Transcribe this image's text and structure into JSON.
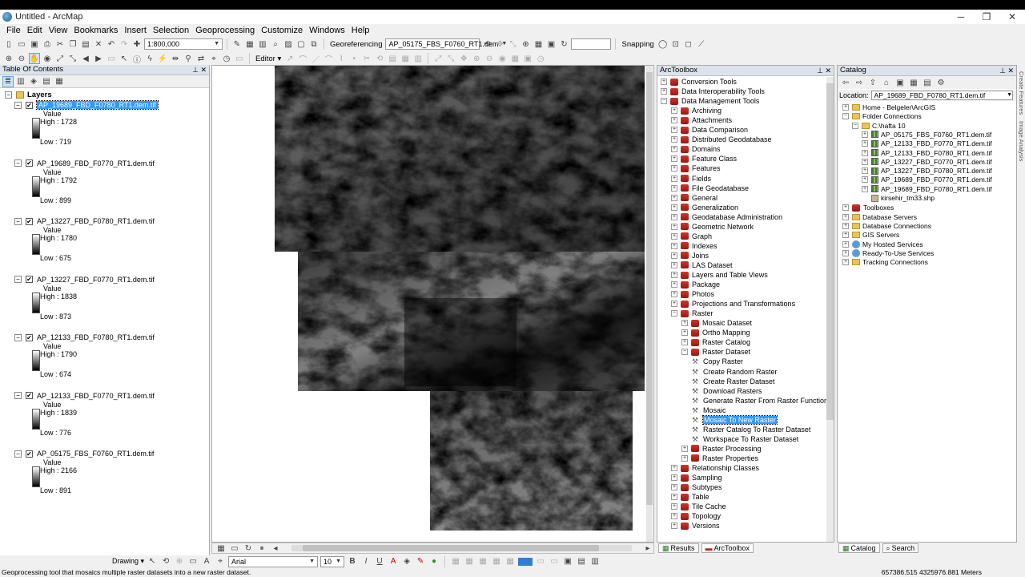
{
  "window": {
    "title": "Untitled - ArcMap",
    "minimize": "─",
    "maximize": "❐",
    "close": "✕"
  },
  "menu": [
    "File",
    "Edit",
    "View",
    "Bookmarks",
    "Insert",
    "Selection",
    "Geoprocessing",
    "Customize",
    "Windows",
    "Help"
  ],
  "toolbar": {
    "scale": "1:800,000",
    "georeferencing_label": "Georeferencing",
    "georef_layer": "AP_05175_FBS_F0760_RT1.dem",
    "snapping_label": "Snapping",
    "editor_label": "Editor"
  },
  "toc": {
    "title": "Table Of Contents",
    "root": "Layers",
    "layers": [
      {
        "name": "AP_19689_FBD_F0780_RT1.dem.tif",
        "value_label": "Value",
        "high": "High : 1728",
        "low": "Low : 719",
        "selected": true
      },
      {
        "name": "AP_19689_FBD_F0770_RT1.dem.tif",
        "value_label": "Value",
        "high": "High : 1792",
        "low": "Low : 899"
      },
      {
        "name": "AP_13227_FBD_F0780_RT1.dem.tif",
        "value_label": "Value",
        "high": "High : 1780",
        "low": "Low : 675"
      },
      {
        "name": "AP_13227_FBD_F0770_RT1.dem.tif",
        "value_label": "Value",
        "high": "High : 1838",
        "low": "Low : 873"
      },
      {
        "name": "AP_12133_FBD_F0780_RT1.dem.tif",
        "value_label": "Value",
        "high": "High : 1790",
        "low": "Low : 674"
      },
      {
        "name": "AP_12133_FBD_F0770_RT1.dem.tif",
        "value_label": "Value",
        "high": "High : 1839",
        "low": "Low : 776"
      },
      {
        "name": "AP_05175_FBS_F0760_RT1.dem.tif",
        "value_label": "Value",
        "high": "High : 2166",
        "low": "Low : 891"
      }
    ]
  },
  "arctoolbox": {
    "title": "ArcToolbox",
    "items": [
      {
        "label": "Conversion Tools",
        "level": 0,
        "kind": "toolbox",
        "exp": "+"
      },
      {
        "label": "Data Interoperability Tools",
        "level": 0,
        "kind": "toolbox",
        "exp": "+"
      },
      {
        "label": "Data Management Tools",
        "level": 0,
        "kind": "toolbox",
        "exp": "−"
      },
      {
        "label": "Archiving",
        "level": 1,
        "kind": "toolbox",
        "exp": "+"
      },
      {
        "label": "Attachments",
        "level": 1,
        "kind": "toolbox",
        "exp": "+"
      },
      {
        "label": "Data Comparison",
        "level": 1,
        "kind": "toolbox",
        "exp": "+"
      },
      {
        "label": "Distributed Geodatabase",
        "level": 1,
        "kind": "toolbox",
        "exp": "+"
      },
      {
        "label": "Domains",
        "level": 1,
        "kind": "toolbox",
        "exp": "+"
      },
      {
        "label": "Feature Class",
        "level": 1,
        "kind": "toolbox",
        "exp": "+"
      },
      {
        "label": "Features",
        "level": 1,
        "kind": "toolbox",
        "exp": "+"
      },
      {
        "label": "Fields",
        "level": 1,
        "kind": "toolbox",
        "exp": "+"
      },
      {
        "label": "File Geodatabase",
        "level": 1,
        "kind": "toolbox",
        "exp": "+"
      },
      {
        "label": "General",
        "level": 1,
        "kind": "toolbox",
        "exp": "+"
      },
      {
        "label": "Generalization",
        "level": 1,
        "kind": "toolbox",
        "exp": "+"
      },
      {
        "label": "Geodatabase Administration",
        "level": 1,
        "kind": "toolbox",
        "exp": "+"
      },
      {
        "label": "Geometric Network",
        "level": 1,
        "kind": "toolbox",
        "exp": "+"
      },
      {
        "label": "Graph",
        "level": 1,
        "kind": "toolbox",
        "exp": "+"
      },
      {
        "label": "Indexes",
        "level": 1,
        "kind": "toolbox",
        "exp": "+"
      },
      {
        "label": "Joins",
        "level": 1,
        "kind": "toolbox",
        "exp": "+"
      },
      {
        "label": "LAS Dataset",
        "level": 1,
        "kind": "toolbox",
        "exp": "+"
      },
      {
        "label": "Layers and Table Views",
        "level": 1,
        "kind": "toolbox",
        "exp": "+"
      },
      {
        "label": "Package",
        "level": 1,
        "kind": "toolbox",
        "exp": "+"
      },
      {
        "label": "Photos",
        "level": 1,
        "kind": "toolbox",
        "exp": "+"
      },
      {
        "label": "Projections and Transformations",
        "level": 1,
        "kind": "toolbox",
        "exp": "+"
      },
      {
        "label": "Raster",
        "level": 1,
        "kind": "toolbox",
        "exp": "−"
      },
      {
        "label": "Mosaic Dataset",
        "level": 2,
        "kind": "toolbox",
        "exp": "+"
      },
      {
        "label": "Ortho Mapping",
        "level": 2,
        "kind": "toolbox",
        "exp": "+"
      },
      {
        "label": "Raster Catalog",
        "level": 2,
        "kind": "toolbox",
        "exp": "+"
      },
      {
        "label": "Raster Dataset",
        "level": 2,
        "kind": "toolbox",
        "exp": "−"
      },
      {
        "label": "Copy Raster",
        "level": 3,
        "kind": "tool"
      },
      {
        "label": "Create Random Raster",
        "level": 3,
        "kind": "tool"
      },
      {
        "label": "Create Raster Dataset",
        "level": 3,
        "kind": "tool"
      },
      {
        "label": "Download Rasters",
        "level": 3,
        "kind": "tool"
      },
      {
        "label": "Generate Raster From Raster Function",
        "level": 3,
        "kind": "tool"
      },
      {
        "label": "Mosaic",
        "level": 3,
        "kind": "tool"
      },
      {
        "label": "Mosaic To New Raster",
        "level": 3,
        "kind": "tool",
        "selected": true
      },
      {
        "label": "Raster Catalog To Raster Dataset",
        "level": 3,
        "kind": "tool"
      },
      {
        "label": "Workspace To Raster Dataset",
        "level": 3,
        "kind": "tool"
      },
      {
        "label": "Raster Processing",
        "level": 2,
        "kind": "toolbox",
        "exp": "+"
      },
      {
        "label": "Raster Properties",
        "level": 2,
        "kind": "toolbox",
        "exp": "+"
      },
      {
        "label": "Relationship Classes",
        "level": 1,
        "kind": "toolbox",
        "exp": "+"
      },
      {
        "label": "Sampling",
        "level": 1,
        "kind": "toolbox",
        "exp": "+"
      },
      {
        "label": "Subtypes",
        "level": 1,
        "kind": "toolbox",
        "exp": "+"
      },
      {
        "label": "Table",
        "level": 1,
        "kind": "toolbox",
        "exp": "+"
      },
      {
        "label": "Tile Cache",
        "level": 1,
        "kind": "toolbox",
        "exp": "+"
      },
      {
        "label": "Topology",
        "level": 1,
        "kind": "toolbox",
        "exp": "+"
      },
      {
        "label": "Versions",
        "level": 1,
        "kind": "toolbox",
        "exp": "+"
      }
    ]
  },
  "catalog": {
    "title": "Catalog",
    "location_label": "Location:",
    "location_value": "AP_19689_FBD_F0780_RT1.dem.tif",
    "items": [
      {
        "label": "Home - Belgeler\\ArcGIS",
        "level": 0,
        "kind": "folder",
        "exp": "+"
      },
      {
        "label": "Folder Connections",
        "level": 0,
        "kind": "folder",
        "exp": "−"
      },
      {
        "label": "C:\\hafta 10",
        "level": 1,
        "kind": "folder",
        "exp": "−"
      },
      {
        "label": "AP_05175_FBS_F0760_RT1.dem.tif",
        "level": 2,
        "kind": "raster",
        "exp": "+"
      },
      {
        "label": "AP_12133_FBD_F0770_RT1.dem.tif",
        "level": 2,
        "kind": "raster",
        "exp": "+"
      },
      {
        "label": "AP_12133_FBD_F0780_RT1.dem.tif",
        "level": 2,
        "kind": "raster",
        "exp": "+"
      },
      {
        "label": "AP_13227_FBD_F0770_RT1.dem.tif",
        "level": 2,
        "kind": "raster",
        "exp": "+"
      },
      {
        "label": "AP_13227_FBD_F0780_RT1.dem.tif",
        "level": 2,
        "kind": "raster",
        "exp": "+"
      },
      {
        "label": "AP_19689_FBD_F0770_RT1.dem.tif",
        "level": 2,
        "kind": "raster",
        "exp": "+"
      },
      {
        "label": "AP_19689_FBD_F0780_RT1.dem.tif",
        "level": 2,
        "kind": "raster",
        "exp": "+"
      },
      {
        "label": "kirsehir_tm33.shp",
        "level": 2,
        "kind": "shape"
      },
      {
        "label": "Toolboxes",
        "level": 0,
        "kind": "toolbox",
        "exp": "+"
      },
      {
        "label": "Database Servers",
        "level": 0,
        "kind": "server",
        "exp": "+"
      },
      {
        "label": "Database Connections",
        "level": 0,
        "kind": "server",
        "exp": "+"
      },
      {
        "label": "GIS Servers",
        "level": 0,
        "kind": "server",
        "exp": "+"
      },
      {
        "label": "My Hosted Services",
        "level": 0,
        "kind": "globe",
        "exp": "+"
      },
      {
        "label": "Ready-To-Use Services",
        "level": 0,
        "kind": "globe",
        "exp": "+"
      },
      {
        "label": "Tracking Connections",
        "level": 0,
        "kind": "folder",
        "exp": "+"
      }
    ],
    "side_tabs": [
      "Create Features",
      "Image Analysis"
    ]
  },
  "tabs": {
    "results": "Results",
    "arctoolbox": "ArcToolbox",
    "catalog": "Catalog",
    "search": "Search"
  },
  "drawbar": {
    "drawing_label": "Drawing",
    "font_name": "Arial",
    "font_size": "10",
    "bold": "B",
    "italic": "I",
    "underline": "U"
  },
  "status": {
    "message": "Geoprocessing tool that mosaics multiple raster datasets into a new raster dataset.",
    "coordinates": "657386.515  4325976.881 Meters"
  }
}
